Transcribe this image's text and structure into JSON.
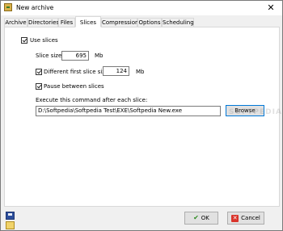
{
  "window": {
    "title": "New archive",
    "close_glyph": "✕"
  },
  "tabs": [
    {
      "label": "Archive"
    },
    {
      "label": "Directories"
    },
    {
      "label": "Files"
    },
    {
      "label": "Slices",
      "active": true
    },
    {
      "label": "Compression"
    },
    {
      "label": "Options"
    },
    {
      "label": "Scheduling"
    }
  ],
  "slices": {
    "use_slices": {
      "label": "Use slices",
      "checked": true
    },
    "slice_size": {
      "label": "Slice size",
      "value": "695",
      "unit": "Mb"
    },
    "different_first": {
      "label": "Different first slice size:",
      "checked": true,
      "value": "124",
      "unit": "Mb"
    },
    "pause": {
      "label": "Pause between slices",
      "checked": true
    },
    "execute": {
      "label": "Execute this command after each slice:",
      "value": "D:\\Softpedia\\Softpedia Test\\EXE\\Softpedia New.exe"
    },
    "browse_label": "Browse"
  },
  "footer": {
    "ok_label": "OK",
    "cancel_label": "Cancel",
    "ok_icon": "checkmark-icon",
    "cancel_icon": "x-icon",
    "cancel_glyph": "✕",
    "ok_glyph": "✔"
  },
  "side_icons": [
    "save-icon",
    "open-folder-icon"
  ],
  "watermark": "SOFTPEDIA",
  "colors": {
    "accent": "#0078d7",
    "ok_green": "#2e8b22",
    "cancel_red": "#d9342b"
  }
}
